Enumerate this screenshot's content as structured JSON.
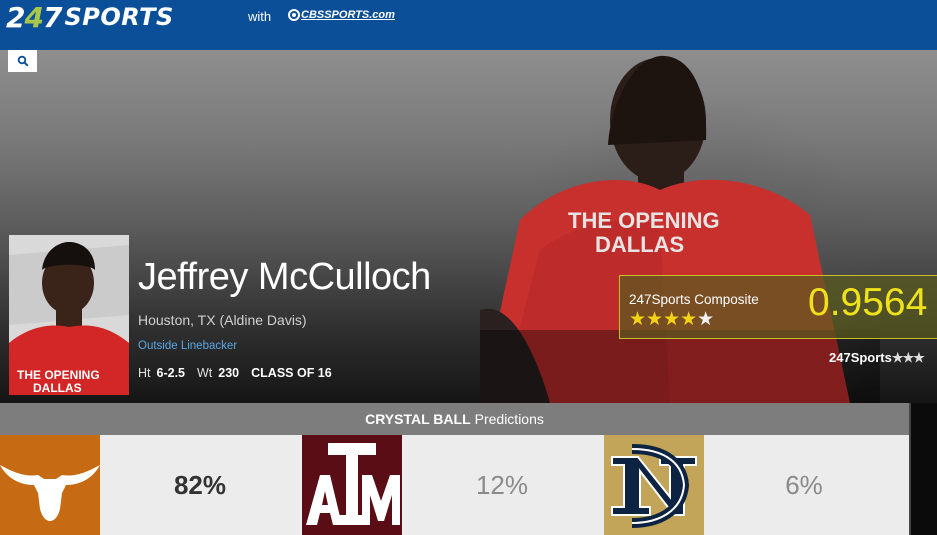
{
  "header": {
    "logo_digits_a": "2",
    "logo_digits_b": "4",
    "logo_digits_c": "7",
    "logo_word": "SPORTS",
    "with_text": "with",
    "partner": "CBSSPORTS.com"
  },
  "search": {
    "icon": "search-icon"
  },
  "player": {
    "name": "Jeffrey McCulloch",
    "hometown": "Houston, TX (Aldine Davis)",
    "position": "Outside Linebacker",
    "height_label": "Ht",
    "height": "6-2.5",
    "weight_label": "Wt",
    "weight": "230",
    "class": "CLASS OF 16",
    "shirt_line1": "THE OPENING",
    "shirt_line2": "DALLAS"
  },
  "composite": {
    "label": "247Sports Composite",
    "stars_on": "★★★★",
    "stars_off": "★",
    "rating": "0.9564",
    "star_count": 4
  },
  "own_rating": {
    "label": "247Sports",
    "stars": "★★★"
  },
  "crystal_ball": {
    "title_bold": "CRYSTAL BALL",
    "title_rest": "Predictions",
    "predictions": [
      {
        "team": "Texas",
        "logo_text": "",
        "pct": "82%",
        "color": "#c66a13"
      },
      {
        "team": "Texas A&M",
        "logo_text": "ATM",
        "pct": "12%",
        "color": "#5a0d14"
      },
      {
        "team": "Notre Dame",
        "logo_text": "ND",
        "pct": "6%",
        "color": "#c3a55a"
      }
    ]
  },
  "colors": {
    "topbar": "#0a4f98",
    "accent_green": "#a9c84b",
    "composite_yellow": "#f0e21a",
    "position_link": "#5aa7e6"
  }
}
